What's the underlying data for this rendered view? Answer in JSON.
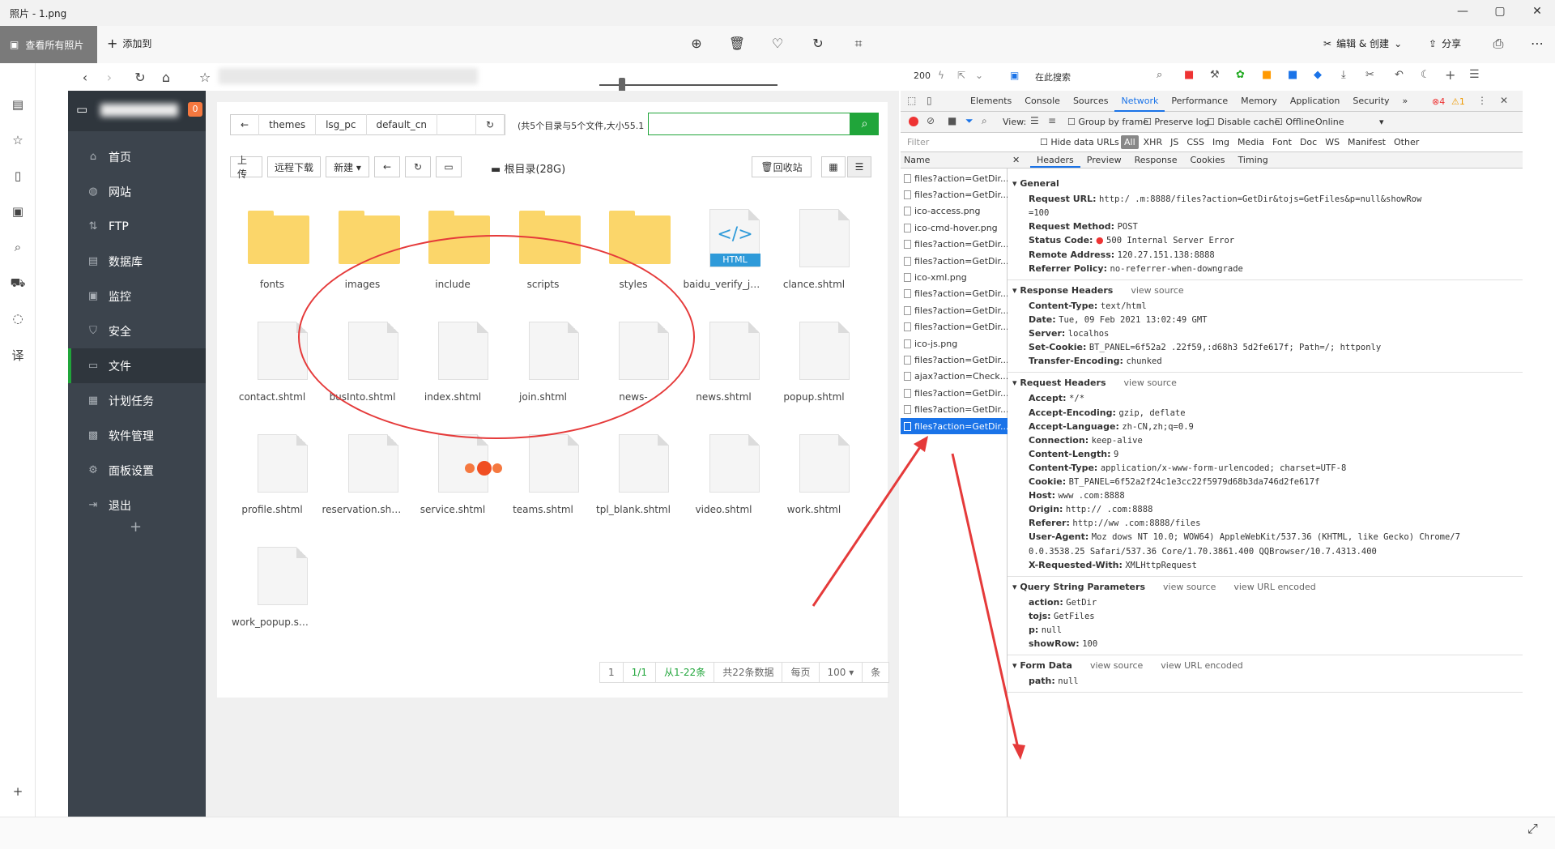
{
  "window": {
    "title": "照片 - 1.png",
    "controls": [
      "—",
      "▢",
      "✕"
    ]
  },
  "app_toolbar": {
    "view_all": "查看所有照片",
    "add_to": "添加到",
    "edit_create": "编辑 & 创建",
    "share": "分享"
  },
  "panel": {
    "badge": "0",
    "menu": [
      {
        "label": "首页",
        "icon": "home-icon",
        "glyph": "⌂"
      },
      {
        "label": "网站",
        "icon": "globe-icon",
        "glyph": "◍"
      },
      {
        "label": "FTP",
        "icon": "ftp-icon",
        "glyph": "⇅"
      },
      {
        "label": "数据库",
        "icon": "database-icon",
        "glyph": "▤"
      },
      {
        "label": "监控",
        "icon": "monitor-icon",
        "glyph": "▣"
      },
      {
        "label": "安全",
        "icon": "shield-icon",
        "glyph": "⛉"
      },
      {
        "label": "文件",
        "icon": "folder-icon",
        "glyph": "▭"
      },
      {
        "label": "计划任务",
        "icon": "calendar-icon",
        "glyph": "▦"
      },
      {
        "label": "软件管理",
        "icon": "apps-icon",
        "glyph": "▩"
      },
      {
        "label": "面板设置",
        "icon": "gear-icon",
        "glyph": "⚙"
      },
      {
        "label": "退出",
        "icon": "logout-icon",
        "glyph": "⇥"
      }
    ],
    "add": "+"
  },
  "files": {
    "breadcrumbs": [
      "themes",
      "lsg_pc",
      "default_cn"
    ],
    "info": "(共5个目录与5个文件,大小55.1",
    "buttons": {
      "upload": "上传",
      "remote_download": "远程下载",
      "new": "新建 ▾",
      "recycle": "回收站"
    },
    "disk": "根目录(28G)",
    "items": [
      {
        "name": "fonts",
        "type": "folder"
      },
      {
        "name": "images",
        "type": "folder"
      },
      {
        "name": "include",
        "type": "folder"
      },
      {
        "name": "scripts",
        "type": "folder"
      },
      {
        "name": "styles",
        "type": "folder"
      },
      {
        "name": "baidu_verify_j3...",
        "type": "html"
      },
      {
        "name": "clance.shtml",
        "type": "file"
      },
      {
        "name": "contact.shtml",
        "type": "file"
      },
      {
        "name": "busInto.shtml",
        "type": "file"
      },
      {
        "name": "index.shtml",
        "type": "file"
      },
      {
        "name": "join.shtml",
        "type": "file"
      },
      {
        "name": "news-",
        "type": "file"
      },
      {
        "name": "news.shtml",
        "type": "file"
      },
      {
        "name": "popup.shtml",
        "type": "file"
      },
      {
        "name": "profile.shtml",
        "type": "file"
      },
      {
        "name": "reservation.shtml",
        "type": "file"
      },
      {
        "name": "service.shtml",
        "type": "file"
      },
      {
        "name": "teams.shtml",
        "type": "file"
      },
      {
        "name": "tpl_blank.shtml",
        "type": "file"
      },
      {
        "name": "video.shtml",
        "type": "file"
      },
      {
        "name": "work.shtml",
        "type": "file"
      },
      {
        "name": "work_popup.sh...",
        "type": "file"
      }
    ],
    "html_badge": "HTML",
    "html_code": "</>",
    "pager": [
      "1",
      "1/1",
      "从1-22条",
      "共22条数据",
      "每页",
      "100 ▾",
      "条"
    ]
  },
  "devtools": {
    "status_count": "200",
    "search": "在此搜索",
    "tabs": [
      "Elements",
      "Console",
      "Sources",
      "Network",
      "Performance",
      "Memory",
      "Application",
      "Security",
      "»"
    ],
    "errors": "4",
    "warnings": "1",
    "toolbar": {
      "view": "View:",
      "group_by_frame": "Group by frame",
      "preserve_log": "Preserve log",
      "disable_cache": "Disable cache",
      "offline": "Offline",
      "online": "Online"
    },
    "filter": {
      "placeholder": "Filter",
      "hide_data_urls": "Hide data URLs",
      "types": [
        "All",
        "XHR",
        "JS",
        "CSS",
        "Img",
        "Media",
        "Font",
        "Doc",
        "WS",
        "Manifest",
        "Other"
      ]
    },
    "list_header": "Name",
    "requests": [
      "files?action=GetDir...",
      "files?action=GetDir...",
      "ico-access.png",
      "ico-cmd-hover.png",
      "files?action=GetDir...",
      "files?action=GetDir...",
      "ico-xml.png",
      "files?action=GetDir...",
      "files?action=GetDir...",
      "files?action=GetDir...",
      "ico-js.png",
      "files?action=GetDir...",
      "ajax?action=Check...",
      "files?action=GetDir...",
      "files?action=GetDir...",
      "files?action=GetDir..."
    ],
    "detail_tabs": [
      "✕",
      "Headers",
      "Preview",
      "Response",
      "Cookies",
      "Timing"
    ],
    "view_source": "view source",
    "view_url_encoded": "view URL encoded",
    "sections": {
      "general": "General",
      "response_headers": "Response Headers",
      "request_headers": "Request Headers",
      "query": "Query String Parameters",
      "form": "Form Data"
    },
    "general": [
      {
        "k": "Request URL:",
        "v": "http:/                              .m:8888/files?action=GetDir&tojs=GetFiles&p=null&showRow"
      },
      {
        "k": "",
        "v": "=100"
      },
      {
        "k": "Request Method:",
        "v": "POST"
      },
      {
        "k": "Status Code:",
        "v": "500 Internal Server Error"
      },
      {
        "k": "Remote Address:",
        "v": "120.27.151.138:8888"
      },
      {
        "k": "Referrer Policy:",
        "v": "no-referrer-when-downgrade"
      }
    ],
    "response_headers": [
      {
        "k": "Content-Type:",
        "v": "text/html"
      },
      {
        "k": "Date:",
        "v": "Tue, 09 Feb 2021 13:02:49 GMT"
      },
      {
        "k": "Server:",
        "v": "localhos"
      },
      {
        "k": "Set-Cookie:",
        "v": "BT_PANEL=6f52a2                 .22f59,:d68h3        5d2fe617f; Path=/; httponly"
      },
      {
        "k": "Transfer-Encoding:",
        "v": "chunked"
      }
    ],
    "request_headers": [
      {
        "k": "Accept:",
        "v": "*/*"
      },
      {
        "k": "Accept-Encoding:",
        "v": "gzip, deflate"
      },
      {
        "k": "Accept-Language:",
        "v": "zh-CN,zh;q=0.9"
      },
      {
        "k": "Connection:",
        "v": "keep-alive"
      },
      {
        "k": "Content-Length:",
        "v": "9"
      },
      {
        "k": "Content-Type:",
        "v": "application/x-www-form-urlencoded; charset=UTF-8"
      },
      {
        "k": "Cookie:",
        "v": "BT_PANEL=6f52a2f24c1e3cc22f5979d68b3da746d2fe617f"
      },
      {
        "k": "Host:",
        "v": "www                    .com:8888"
      },
      {
        "k": "Origin:",
        "v": "http://                   .com:8888"
      },
      {
        "k": "Referer:",
        "v": "http://ww                   .com:8888/files"
      },
      {
        "k": "User-Agent:",
        "v": "Moz              dows NT 10.0; WOW64) AppleWebKit/537.36 (KHTML, like Gecko) Chrome/7"
      },
      {
        "k": "",
        "v": "0.0.3538.25 Safari/537.36 Core/1.70.3861.400 QQBrowser/10.7.4313.400"
      },
      {
        "k": "X-Requested-With:",
        "v": "XMLHttpRequest"
      }
    ],
    "query": [
      {
        "k": "action:",
        "v": "GetDir"
      },
      {
        "k": "tojs:",
        "v": "GetFiles"
      },
      {
        "k": "p:",
        "v": "null"
      },
      {
        "k": "showRow:",
        "v": "100"
      }
    ],
    "form": [
      {
        "k": "path:",
        "v": "null"
      }
    ]
  },
  "colors": {
    "accent_green": "#20a53a",
    "sidebar": "#3c444d",
    "annotation_red": "#e53a3a",
    "devtools_blue": "#1a73e8"
  }
}
